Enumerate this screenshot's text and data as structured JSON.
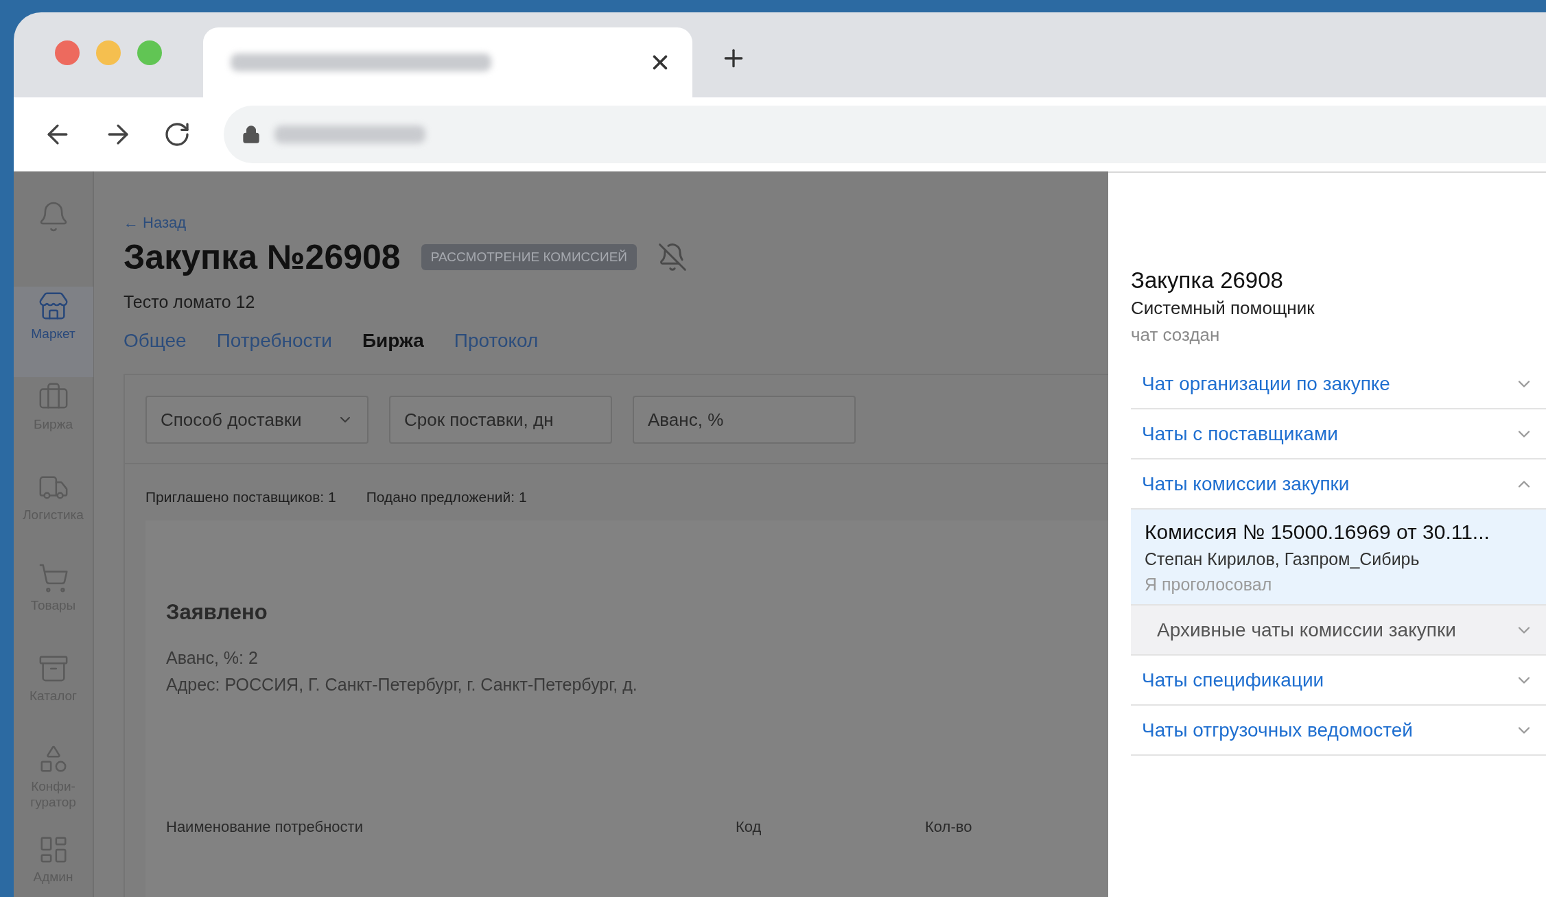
{
  "sidebar": {
    "items": [
      {
        "label": "Маркет",
        "selected": true
      },
      {
        "label": "Биржа",
        "selected": false
      },
      {
        "label": "Логистика",
        "selected": false
      },
      {
        "label": "Товары",
        "selected": false
      },
      {
        "label": "Каталог",
        "selected": false
      },
      {
        "label": "Конфи-гуратор",
        "selected": false
      },
      {
        "label": "Админ",
        "selected": false
      }
    ]
  },
  "back_link": "← Назад",
  "title": "Закупка №26908",
  "status_badge": "РАССМОТРЕНИЕ КОМИССИЕЙ",
  "subtitle": "Тесто ломато 12",
  "tabs": [
    {
      "label": "Общее",
      "selected": false
    },
    {
      "label": "Потребности",
      "selected": false
    },
    {
      "label": "Биржа",
      "selected": true
    },
    {
      "label": "Протокол",
      "selected": false
    }
  ],
  "filters": [
    {
      "kind": "select",
      "placeholder": "Способ доставки"
    },
    {
      "kind": "input",
      "placeholder": "Срок поставки, дн"
    },
    {
      "kind": "input",
      "placeholder": "Аванс, %"
    }
  ],
  "stats": [
    "Приглашено поставщиков: 1",
    "Подано предложений: 1"
  ],
  "card": {
    "heading": "Заявлено",
    "lines": [
      "Аванс, %: 2",
      "Адрес: РОССИЯ, Г. Санкт-Петербург, г. Санкт-Петербург, д."
    ]
  },
  "table": {
    "columns": [
      "Наименование потребности",
      "Код",
      "Кол-во"
    ]
  },
  "chat_panel": {
    "title": "Закупка 26908",
    "subtitle": "Системный помощник",
    "status": "чат создан",
    "sections": [
      {
        "kind": "section",
        "label": "Чат организации по закупке",
        "expanded": false
      },
      {
        "kind": "section",
        "label": "Чаты с поставщиками",
        "expanded": false
      },
      {
        "kind": "section",
        "label": "Чаты комиссии закупки",
        "expanded": true,
        "children": [
          {
            "kind": "chat",
            "title": "Комиссия № 15000.16969 от 30.11...",
            "participants": "Степан Кирилов, Газпром_Сибирь",
            "status": "Я проголосовал",
            "selected": true
          },
          {
            "kind": "archive",
            "label": "Архивные чаты комиссии закупки",
            "expanded": false
          }
        ]
      },
      {
        "kind": "section",
        "label": "Чаты спецификации",
        "expanded": false
      },
      {
        "kind": "section",
        "label": "Чаты отгрузочных ведомостей",
        "expanded": false
      }
    ]
  }
}
